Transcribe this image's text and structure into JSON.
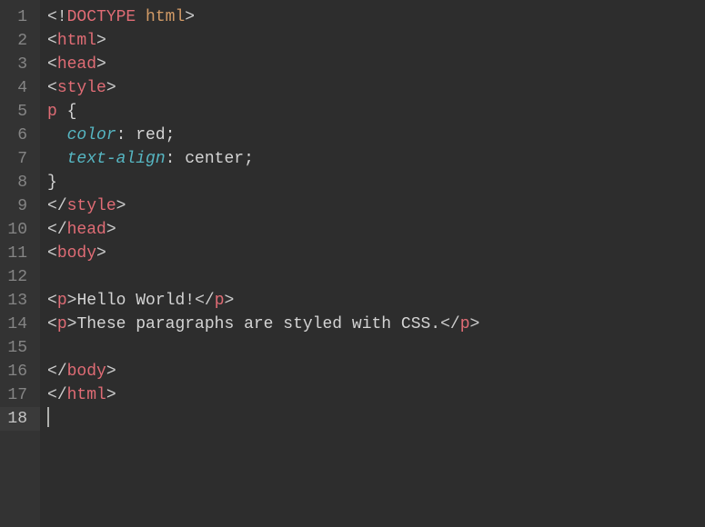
{
  "lines": [
    {
      "num": "1"
    },
    {
      "num": "2"
    },
    {
      "num": "3"
    },
    {
      "num": "4"
    },
    {
      "num": "5"
    },
    {
      "num": "6"
    },
    {
      "num": "7"
    },
    {
      "num": "8"
    },
    {
      "num": "9"
    },
    {
      "num": "10"
    },
    {
      "num": "11"
    },
    {
      "num": "12"
    },
    {
      "num": "13"
    },
    {
      "num": "14"
    },
    {
      "num": "15"
    },
    {
      "num": "16"
    },
    {
      "num": "17"
    },
    {
      "num": "18"
    }
  ],
  "tokens": {
    "doctype_bang": "<!",
    "doctype_word": "DOCTYPE",
    "space": " ",
    "html_word": "html",
    "gt": ">",
    "lt": "<",
    "slash": "/",
    "tag_html": "html",
    "tag_head": "head",
    "tag_style": "style",
    "tag_body": "body",
    "tag_p": "p",
    "css_sel_p": "p ",
    "css_lbrace": "{",
    "css_rbrace": "}",
    "css_indent": "  ",
    "css_prop_color": "color",
    "css_prop_ta": "text-align",
    "css_colon": ": ",
    "css_val_red": "red",
    "css_val_center": "center",
    "semi": ";",
    "txt_hello": "Hello World!",
    "txt_para": "These paragraphs are styled with CSS."
  }
}
